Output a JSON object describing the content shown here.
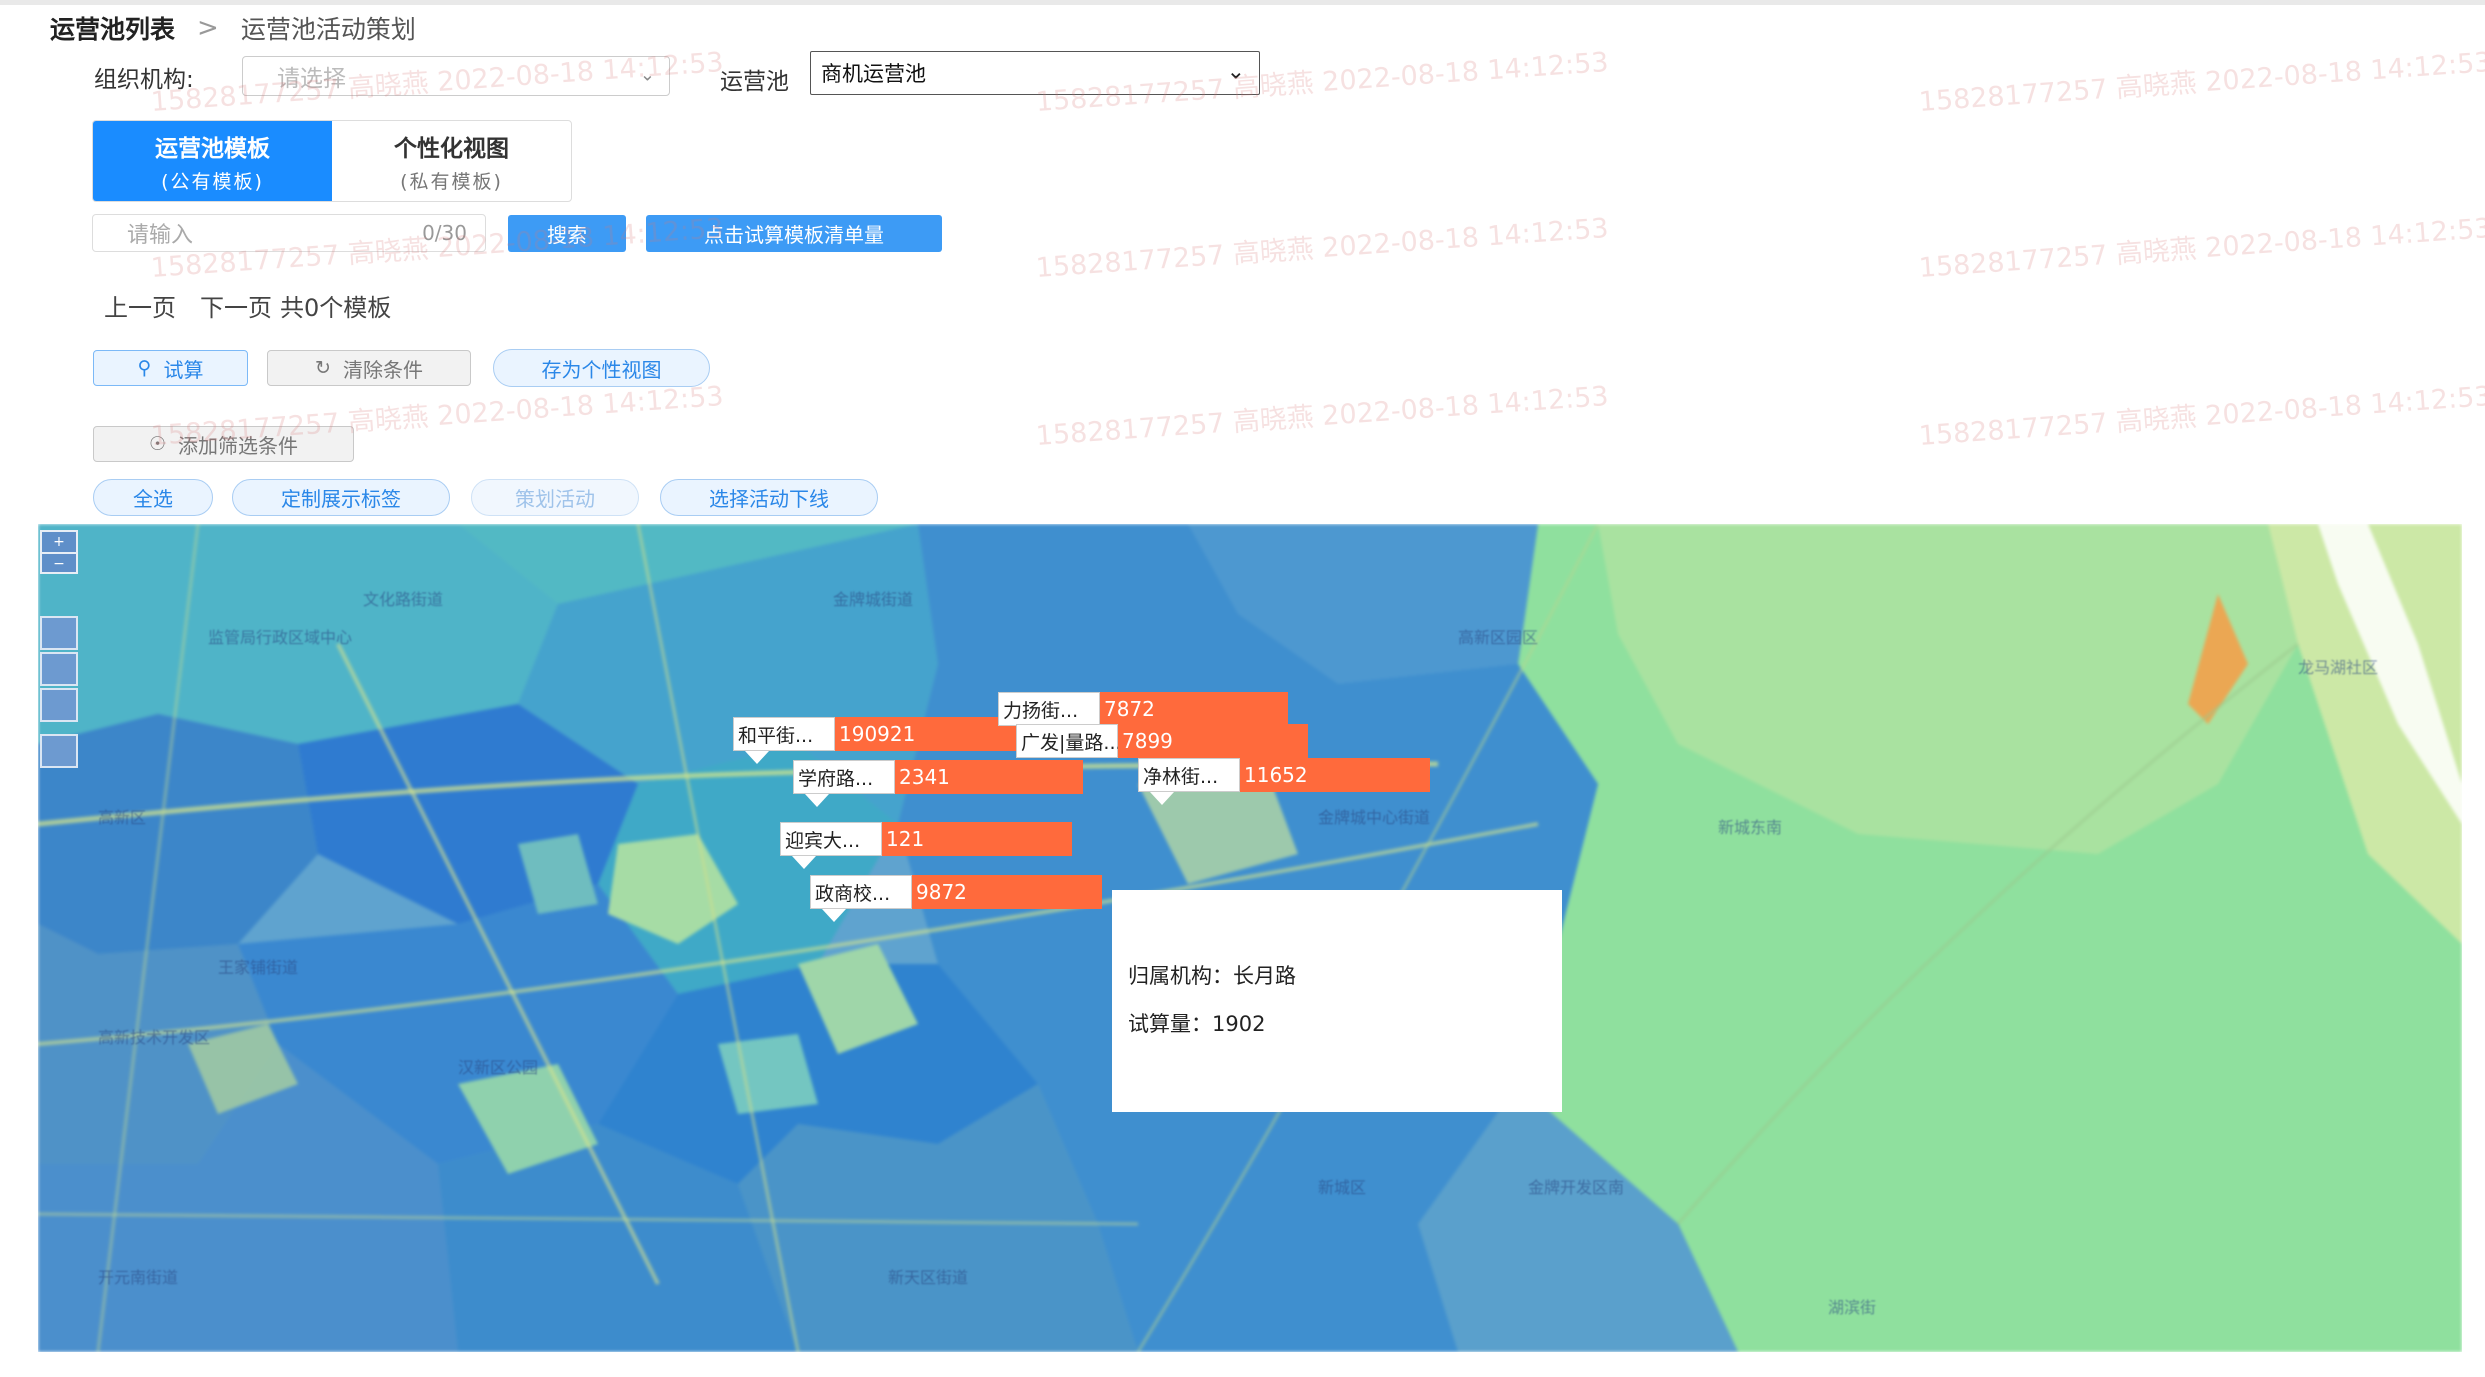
{
  "breadcrumb": {
    "root": "运营池列表",
    "separator": ">",
    "current": "运营池活动策划"
  },
  "filters": {
    "org_label": "组织机构:",
    "org_placeholder": "请选择",
    "pool_label": "运营池",
    "pool_value": "商机运营池"
  },
  "tabs": [
    {
      "title": "运营池模板",
      "subtitle": "(公有模板)",
      "active": true
    },
    {
      "title": "个性化视图",
      "subtitle": "(私有模板)",
      "active": false
    }
  ],
  "search": {
    "placeholder": "请输入",
    "counter": "0/30",
    "search_label": "搜索",
    "calc_list_label": "点击试算模板清单量"
  },
  "pager": {
    "prev": "上一页",
    "next": "下一页",
    "total": "共0个模板"
  },
  "actions": {
    "trial": "试算",
    "clear": "清除条件",
    "save_view": "存为个性视图",
    "add_filter": "添加筛选条件"
  },
  "pills": {
    "select_all": "全选",
    "custom_tags": "定制展示标签",
    "plan_activity": "策划活动",
    "offline_activity": "选择活动下线"
  },
  "watermark": "15828177257 高晓燕 2022-08-18 14:12:53",
  "map_markers": [
    {
      "name": "和平街...",
      "value": "190921"
    },
    {
      "name": "力扬街...",
      "value": "7872"
    },
    {
      "name": "广发|量路...",
      "value": "7899"
    },
    {
      "name": "学府路...",
      "value": "2341"
    },
    {
      "name": "净林街...",
      "value": "11652"
    },
    {
      "name": "迎宾大...",
      "value": "121"
    },
    {
      "name": "政商校...",
      "value": "9872"
    }
  ],
  "tooltip": {
    "org": "归属机构：长月路",
    "amount": "试算量：1902"
  },
  "colors": {
    "primary": "#1a8cff",
    "marker_value": "#ff6a3c"
  },
  "icons": {
    "trial": "search-icon",
    "clear": "refresh-icon",
    "add_filter": "eye-icon",
    "select": "chevron-down-icon"
  }
}
